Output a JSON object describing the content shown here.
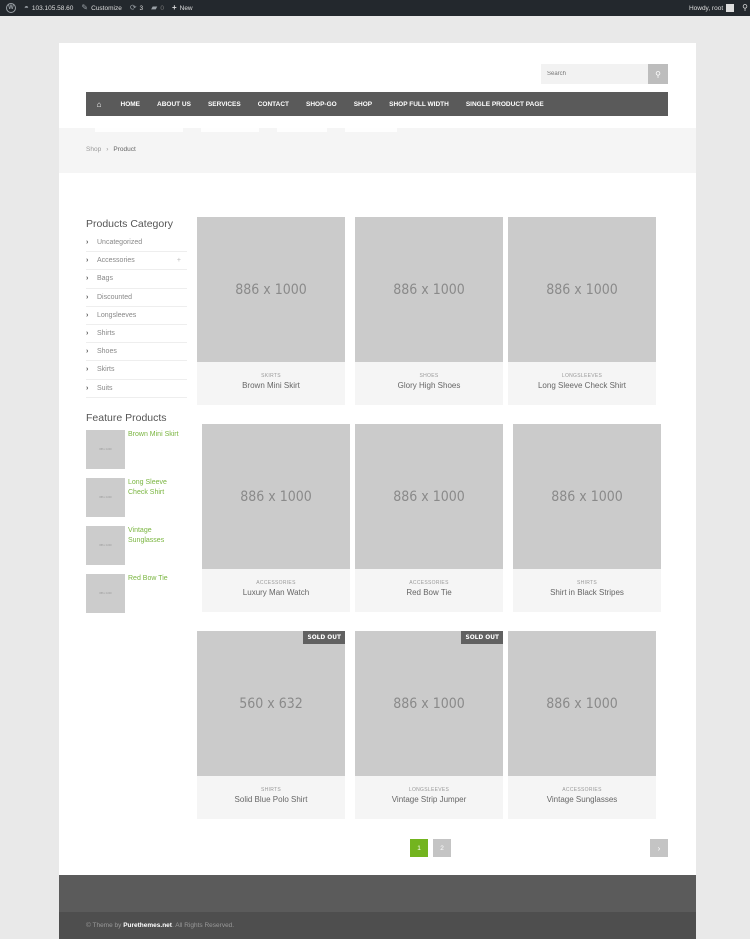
{
  "adminbar": {
    "site_ip": "103.105.58.60",
    "customize": "Customize",
    "updates_count": "3",
    "comments_count": "0",
    "new_label": "New",
    "greeting": "Howdy, root"
  },
  "header": {
    "search_placeholder": "Search"
  },
  "nav": {
    "items": [
      "HOME",
      "ABOUT US",
      "SERVICES",
      "CONTACT",
      "SHOP-GO",
      "SHOP",
      "SHOP FULL WIDTH",
      "SINGLE PRODUCT PAGE"
    ]
  },
  "breadcrumb": {
    "parent": "Shop",
    "separator": "›",
    "current": "Product"
  },
  "sidebar": {
    "categories_title": "Products Category",
    "categories": [
      {
        "label": "Uncategorized",
        "expandable": false
      },
      {
        "label": "Accessories",
        "expandable": true
      },
      {
        "label": "Bags",
        "expandable": false
      },
      {
        "label": "Discounted",
        "expandable": false
      },
      {
        "label": "Longsleeves",
        "expandable": false
      },
      {
        "label": "Shirts",
        "expandable": false
      },
      {
        "label": "Shoes",
        "expandable": false
      },
      {
        "label": "Skirts",
        "expandable": false
      },
      {
        "label": "Suits",
        "expandable": false
      }
    ],
    "expand_symbol": "+",
    "feature_title": "Feature Products",
    "feature_products": [
      {
        "name": "Brown Mini Skirt",
        "thumb": "886 x 1000"
      },
      {
        "name": "Long Sleeve Check Shirt",
        "thumb": "886 x 1000"
      },
      {
        "name": "Vintage Sunglasses",
        "thumb": "886 x 1000"
      },
      {
        "name": "Red Bow Tie",
        "thumb": "886 x 1000"
      }
    ]
  },
  "products": [
    {
      "image": "886 x 1000",
      "category": "SKIRTS",
      "name": "Brown Mini Skirt",
      "badge": ""
    },
    {
      "image": "886 x 1000",
      "category": "SHOES",
      "name": "Glory High Shoes",
      "badge": ""
    },
    {
      "image": "886 x 1000",
      "category": "LONGSLEEVES",
      "name": "Long Sleeve Check Shirt",
      "badge": ""
    },
    {
      "image": "886 x 1000",
      "category": "ACCESSORIES",
      "name": "Luxury Man Watch",
      "badge": ""
    },
    {
      "image": "886 x 1000",
      "category": "ACCESSORIES",
      "name": "Red Bow Tie",
      "badge": ""
    },
    {
      "image": "886 x 1000",
      "category": "SHIRTS",
      "name": "Shirt in Black Stripes",
      "badge": ""
    },
    {
      "image": "560 x 632",
      "category": "SHIRTS",
      "name": "Solid Blue Polo Shirt",
      "badge": "SOLD OUT"
    },
    {
      "image": "886 x 1000",
      "category": "LONGSLEEVES",
      "name": "Vintage Strip Jumper",
      "badge": "SOLD OUT"
    },
    {
      "image": "886 x 1000",
      "category": "ACCESSORIES",
      "name": "Vintage Sunglasses",
      "badge": ""
    }
  ],
  "pagination": {
    "pages": [
      "1",
      "2"
    ],
    "current": "1",
    "next_symbol": "›"
  },
  "footer": {
    "prefix": "© Theme by ",
    "brand": "Purethemes.net",
    "suffix": ". All Rights Reserved."
  },
  "colors": {
    "accent": "#73b41f",
    "link_green": "#7ab540",
    "nav_bg": "#5a5a5a",
    "adminbar_bg": "#23282d"
  }
}
